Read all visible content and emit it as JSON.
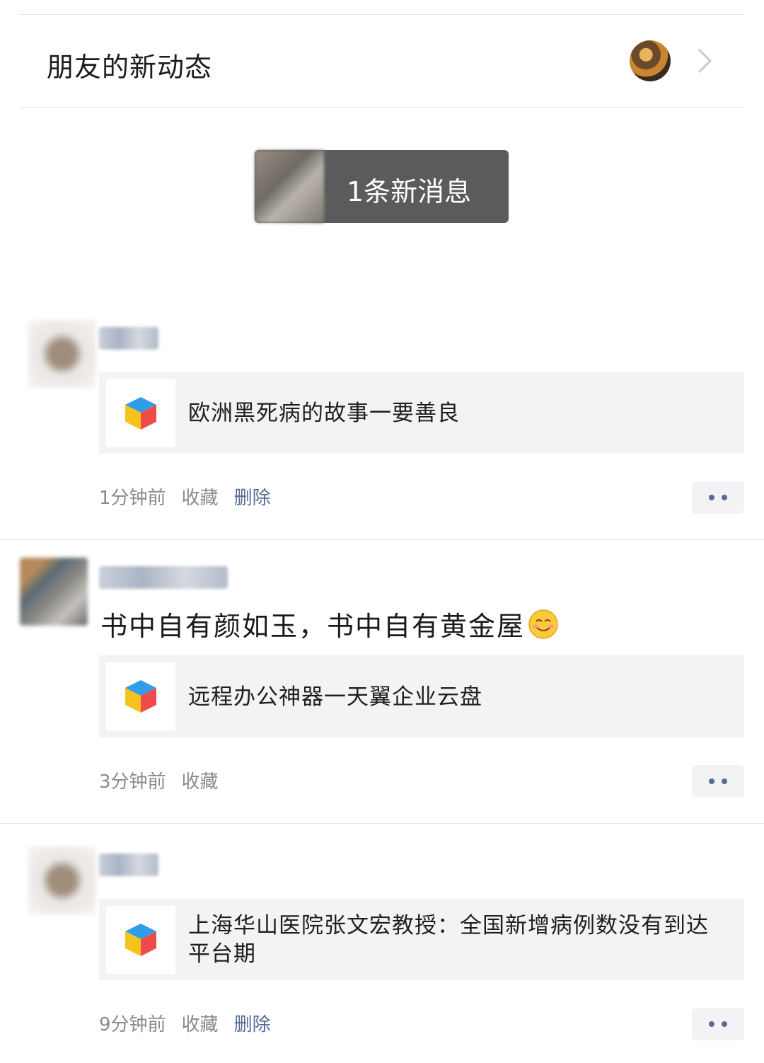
{
  "header": {
    "title": "朋友的新动态"
  },
  "notice": {
    "label": "1条新消息"
  },
  "posts": [
    {
      "text": "",
      "card_title": "欧洲黑死病的故事一要善良",
      "time": "1分钟前",
      "favorite": "收藏",
      "delete": "删除"
    },
    {
      "text": "书中自有颜如玉，书中自有黄金屋",
      "card_title": "远程办公神器一天翼企业云盘",
      "time": "3分钟前",
      "favorite": "收藏",
      "delete": ""
    },
    {
      "text": "",
      "card_title": "上海华山医院张文宏教授：全国新增病例数没有到达平台期",
      "time": "9分钟前",
      "favorite": "收藏",
      "delete": "删除"
    }
  ],
  "colors": {
    "link": "#576b95",
    "meta": "#8a8a8a",
    "card_bg": "#f3f3f5",
    "notice_bg": "#5b5b5b"
  },
  "icons": [
    "chevron-right-icon",
    "cube-app-icon",
    "smile-emoji-icon",
    "more-dots-icon"
  ]
}
